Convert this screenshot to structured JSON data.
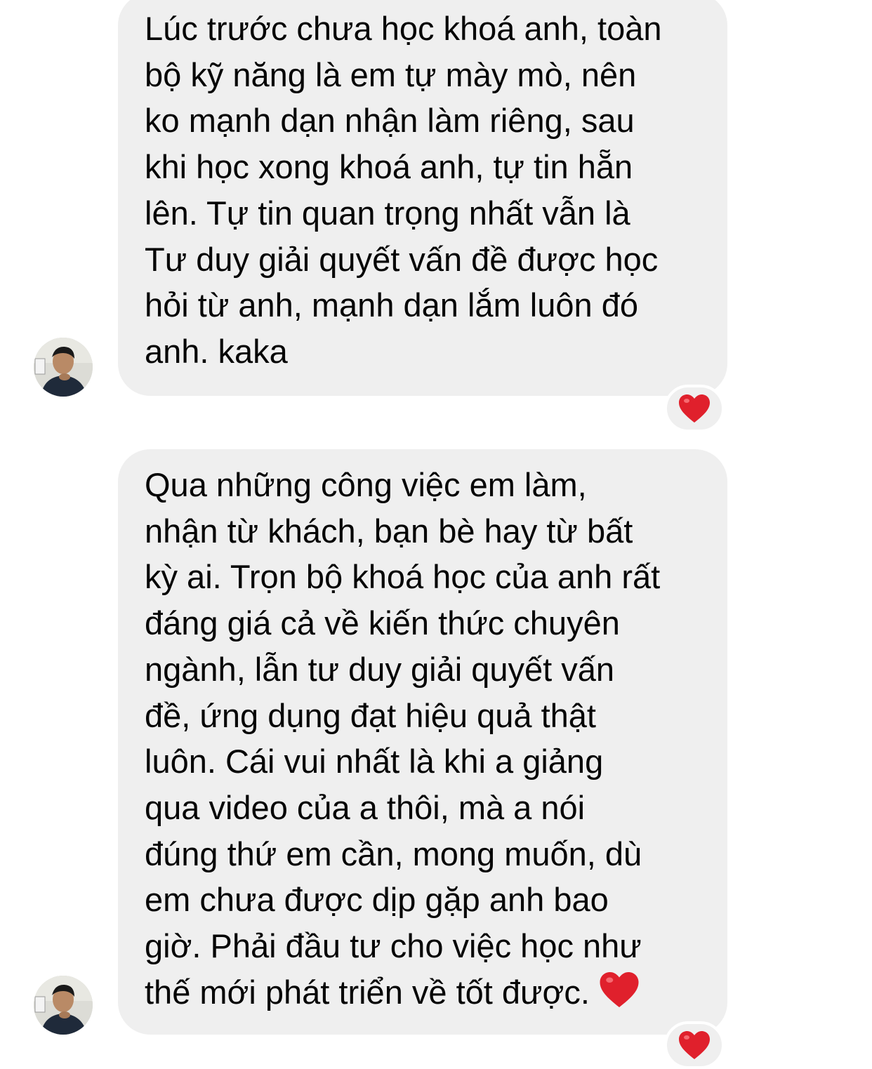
{
  "messages": [
    {
      "sender": "contact",
      "lines": [
        "Lúc trước chưa học khoá anh, toàn",
        "bộ kỹ năng là em tự mày mò, nên",
        "ko mạnh dạn nhận làm riêng, sau",
        "khi học xong khoá anh, tự tin hẵn",
        "lên. Tự tin quan trọng nhất vẫn là",
        "Tư duy giải quyết vấn đề được học",
        "hỏi từ anh, mạnh dạn lắm luôn đó",
        "anh. kaka"
      ],
      "reaction": "heart-icon",
      "reaction_color": "#e0202c"
    },
    {
      "sender": "contact",
      "lines": [
        "Qua những công việc em làm,",
        "nhận từ khách, bạn bè hay từ bất",
        "kỳ ai. Trọn bộ khoá học của anh rất",
        "đáng giá cả về kiến thức chuyên",
        "ngành, lẫn tư duy giải quyết vấn",
        "đề, ứng dụng đạt hiệu quả thật",
        "luôn. Cái vui nhất là khi a giảng",
        "qua video của a thôi, mà a nói",
        "đúng thứ em cần, mong muốn, dù",
        "em chưa được dịp gặp anh bao",
        "giờ. Phải đầu tư cho việc học như",
        "thế mới phát triển về tốt được."
      ],
      "trailing_emoji": "heart-icon",
      "reaction": "heart-icon",
      "reaction_color": "#e0202c"
    }
  ],
  "colors": {
    "bubble_bg": "#efefef",
    "text": "#050505",
    "page_bg": "#ffffff",
    "heart": "#e0202c"
  }
}
